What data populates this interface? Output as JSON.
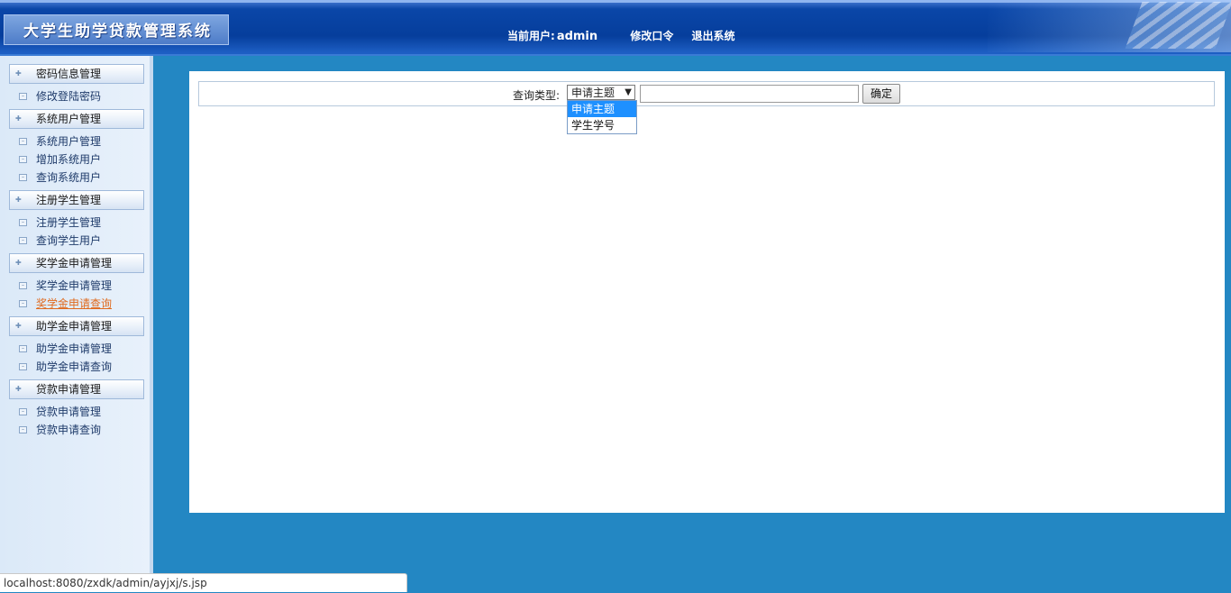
{
  "header": {
    "title": "大学生助学贷款管理系统",
    "current_user_label": "当前用户:",
    "current_user": "admin",
    "change_password": "修改口令",
    "logout": "退出系统"
  },
  "sidebar": {
    "groups": [
      {
        "label": "密码信息管理",
        "items": [
          "修改登陆密码"
        ]
      },
      {
        "label": "系统用户管理",
        "items": [
          "系统用户管理",
          "增加系统用户",
          "查询系统用户"
        ]
      },
      {
        "label": "注册学生管理",
        "items": [
          "注册学生管理",
          "查询学生用户"
        ]
      },
      {
        "label": "奖学金申请管理",
        "items": [
          "奖学金申请管理",
          "奖学金申请查询"
        ]
      },
      {
        "label": "助学金申请管理",
        "items": [
          "助学金申请管理",
          "助学金申请查询"
        ]
      },
      {
        "label": "贷款申请管理",
        "items": [
          "贷款申请管理",
          "贷款申请查询"
        ]
      }
    ],
    "active_item": "奖学金申请查询"
  },
  "query": {
    "type_label": "查询类型:",
    "selected": "申请主题",
    "options": [
      "申请主题",
      "学生学号"
    ],
    "keyword_value": "",
    "submit": "确定"
  },
  "status_bar": {
    "url": "localhost:8080/zxdk/admin/ayjxj/s.jsp"
  }
}
